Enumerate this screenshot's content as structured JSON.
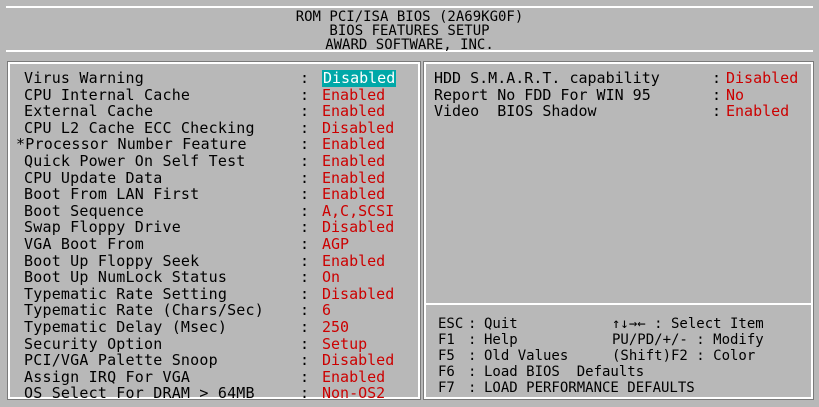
{
  "header": {
    "line1": "ROM PCI/ISA BIOS (2A69KG0F)",
    "line2": "BIOS FEATURES SETUP",
    "line3": "AWARD SOFTWARE, INC."
  },
  "settings": [
    {
      "label": "Virus Warning",
      "value": "Disabled",
      "selected": true
    },
    {
      "label": "CPU Internal Cache",
      "value": "Enabled"
    },
    {
      "label": "External Cache",
      "value": "Enabled"
    },
    {
      "label": "CPU L2 Cache ECC Checking",
      "value": "Disabled"
    },
    {
      "label": "*Processor Number Feature",
      "value": "Enabled"
    },
    {
      "label": "Quick Power On Self Test",
      "value": "Enabled"
    },
    {
      "label": "CPU Update Data",
      "value": "Enabled"
    },
    {
      "label": "Boot From LAN First",
      "value": "Enabled"
    },
    {
      "label": "Boot Sequence",
      "value": "A,C,SCSI"
    },
    {
      "label": "Swap Floppy Drive",
      "value": "Disabled"
    },
    {
      "label": "VGA Boot From",
      "value": "AGP"
    },
    {
      "label": "Boot Up Floppy Seek",
      "value": "Enabled"
    },
    {
      "label": "Boot Up NumLock Status",
      "value": "On"
    },
    {
      "label": "Typematic Rate Setting",
      "value": "Disabled"
    },
    {
      "label": "Typematic Rate (Chars/Sec)",
      "value": "6"
    },
    {
      "label": "Typematic Delay (Msec)",
      "value": "250"
    },
    {
      "label": "Security Option",
      "value": "Setup"
    },
    {
      "label": "PCI/VGA Palette Snoop",
      "value": "Disabled"
    },
    {
      "label": "Assign IRQ For VGA",
      "value": "Enabled"
    },
    {
      "label": "OS Select For DRAM > 64MB",
      "value": "Non-OS2"
    }
  ],
  "right_settings": [
    {
      "label": "HDD S.M.A.R.T. capability",
      "value": "Disabled"
    },
    {
      "label": "Report No FDD For WIN 95",
      "value": "No"
    },
    {
      "label": "Video  BIOS Shadow",
      "value": "Enabled"
    }
  ],
  "help": [
    {
      "key": "ESC",
      "desc": "Quit",
      "right": "↑↓→← : Select Item"
    },
    {
      "key": "F1",
      "desc": "Help",
      "right": "PU/PD/+/- : Modify"
    },
    {
      "key": "F5",
      "desc": "Old Values",
      "right": "(Shift)F2 : Color"
    },
    {
      "key": "F6",
      "desc": "Load BIOS  Defaults",
      "right": ""
    },
    {
      "key": "F7",
      "desc": "LOAD PERFORMANCE DEFAULTS",
      "right": ""
    }
  ],
  "colors": {
    "background": "#b8b8b8",
    "value": "#cc0000",
    "highlight": "#00a8a8"
  }
}
